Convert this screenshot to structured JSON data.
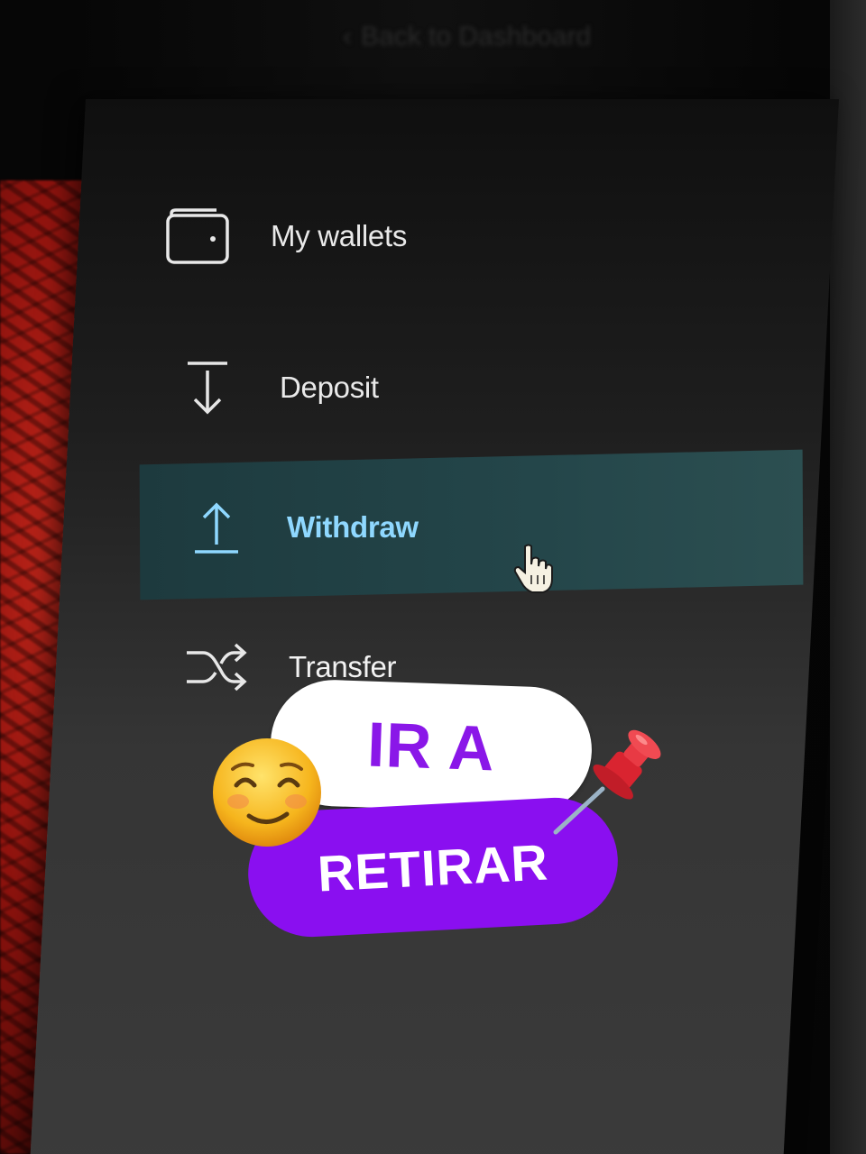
{
  "back_link": {
    "label": "Back to Dashboard"
  },
  "nav": {
    "items": [
      {
        "label": "My wallets",
        "icon": "wallet-icon"
      },
      {
        "label": "Deposit",
        "icon": "deposit-arrow-icon"
      },
      {
        "label": "Withdraw",
        "icon": "withdraw-arrow-icon",
        "active": true
      },
      {
        "label": "Transfer",
        "icon": "shuffle-icon"
      }
    ]
  },
  "overlay": {
    "line1": "IR A",
    "line2": "RETIRAR",
    "emoji_left": "smiling-face-icon",
    "emoji_right": "pushpin-icon"
  },
  "colors": {
    "active_text": "#8fd8ff",
    "active_bg": "#24464a",
    "sticker_purple": "#8a0ff0"
  }
}
